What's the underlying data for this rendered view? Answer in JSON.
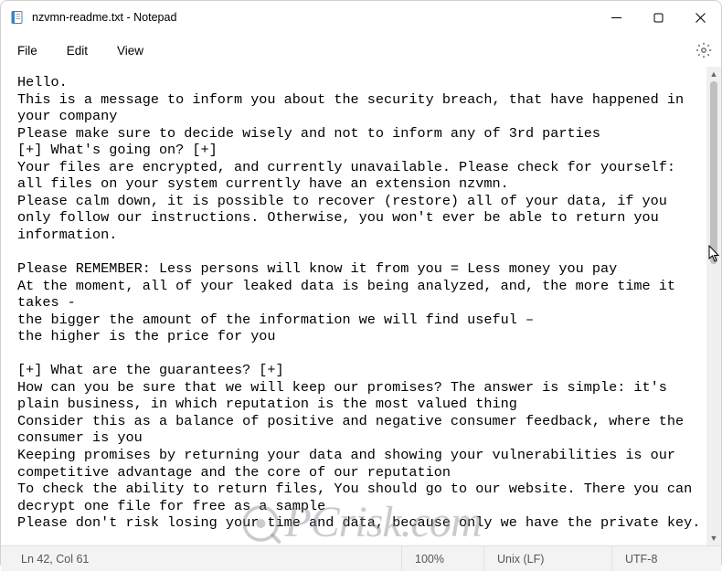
{
  "window": {
    "title": "nzvmn-readme.txt - Notepad"
  },
  "menu": {
    "file": "File",
    "edit": "Edit",
    "view": "View"
  },
  "content": {
    "text": "Hello.\nThis is a message to inform you about the security breach, that have happened in your company\nPlease make sure to decide wisely and not to inform any of 3rd parties\n[+] What's going on? [+]\nYour files are encrypted, and currently unavailable. Please check for yourself: all files on your system currently have an extension nzvmn.\nPlease calm down, it is possible to recover (restore) all of your data, if you only follow our instructions. Otherwise, you won't ever be able to return you information.\n\nPlease REMEMBER: Less persons will know it from you = Less money you pay\nAt the moment, all of your leaked data is being analyzed, and, the more time it takes -\nthe bigger the amount of the information we will find useful –\nthe higher is the price for you\n\n[+] What are the guarantees? [+]\nHow can you be sure that we will keep our promises? The answer is simple: it's plain business, in which reputation is the most valued thing\nConsider this as a balance of positive and negative consumer feedback, where the consumer is you\nKeeping promises by returning your data and showing your vulnerabilities is our competitive advantage and the core of our reputation\nTo check the ability to return files, You should go to our website. There you can decrypt one file for free as a sample\nPlease don't risk losing your time and data, because only we have the private key."
  },
  "status": {
    "caret": "Ln 42, Col 61",
    "zoom": "100%",
    "lineending": "Unix (LF)",
    "encoding": "UTF-8"
  },
  "watermark": {
    "text": "PCrisk.com"
  }
}
